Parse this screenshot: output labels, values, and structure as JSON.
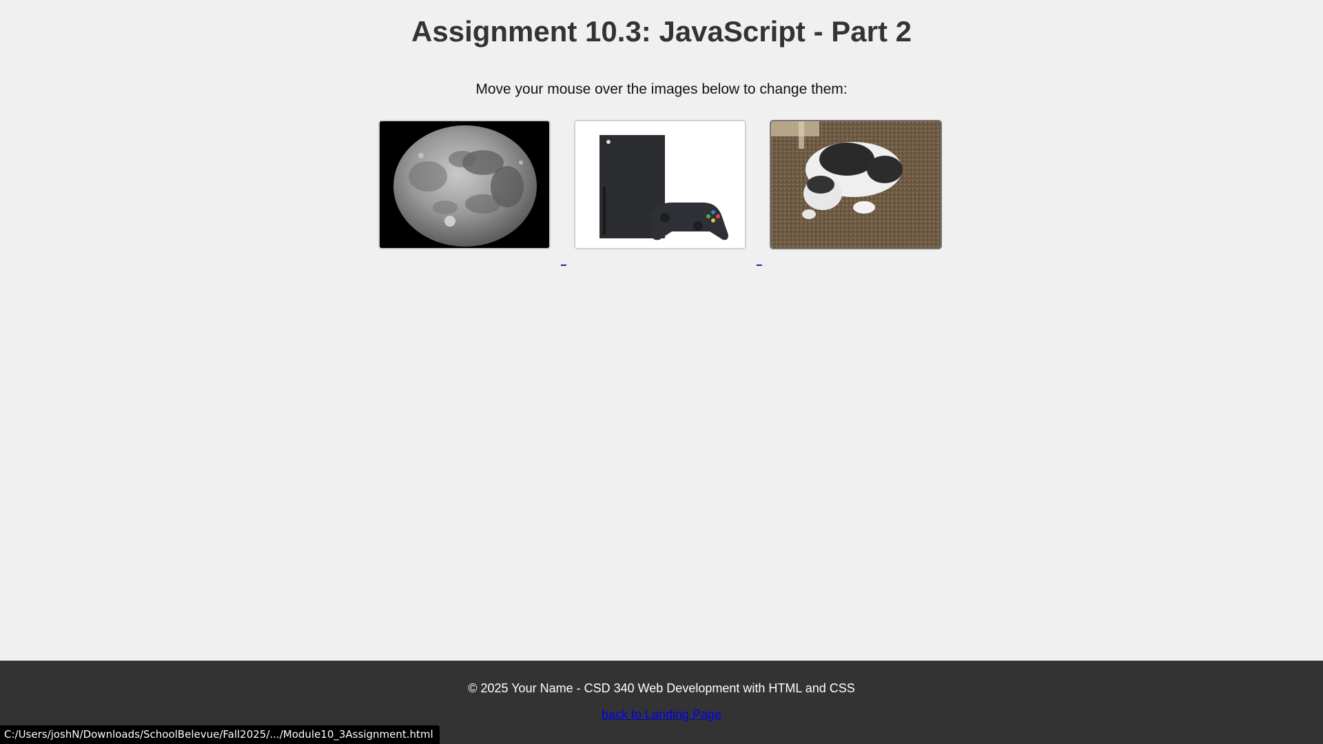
{
  "page": {
    "title": "Assignment 10.3: JavaScript - Part 2",
    "instructions": "Move your mouse over the images below to change them:"
  },
  "gallery": {
    "images": [
      {
        "name": "moon",
        "alt": "moon"
      },
      {
        "name": "xbox",
        "alt": "xbox"
      },
      {
        "name": "cat",
        "alt": "cat"
      }
    ],
    "link_gap_label": "_"
  },
  "footer": {
    "copyright": "© 2025 Your Name - CSD 340 Web Development with HTML and CSS",
    "back_link": "back to Landing Page"
  },
  "status_bar": {
    "url": "C:/Users/joshN/Downloads/SchoolBelevue/Fall2025/.../Module10_3Assignment.html"
  },
  "colors": {
    "background": "#f0f0f0",
    "footer_bg": "#333333",
    "link": "#0000ee"
  }
}
